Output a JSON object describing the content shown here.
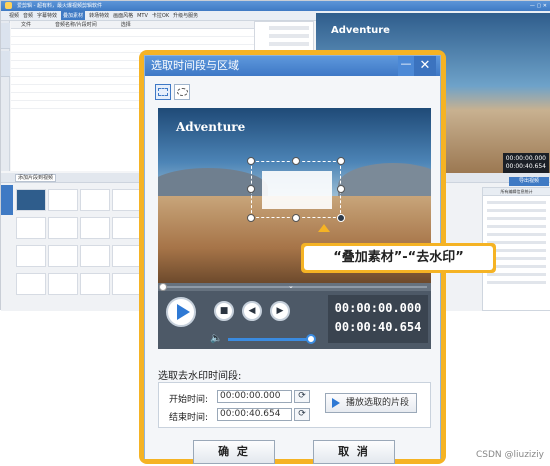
{
  "background_app": {
    "title": "爱剪辑 - 超有料，最火爆视频剪辑软件",
    "menu_items": [
      "视频",
      "音频",
      "字幕特效",
      "叠加素材",
      "转场特效",
      "画面风格",
      "MTV",
      "卡拉OK",
      "升级与服务"
    ],
    "active_menu": "叠加素材",
    "list_headers": [
      "文件",
      "音频名称/片段时间",
      "选择"
    ],
    "preview_title": "Adventure",
    "preview_timecode_1": "00:00:00.000",
    "preview_timecode_2": "00:00:40.654",
    "export_button": "导出视频",
    "timeline_tab": "添加片段到视频",
    "props_title": "所有编辑信息统计"
  },
  "dialog": {
    "title": "选取时间段与区域",
    "minimize": "—",
    "close": "✕",
    "video_title": "Adventure",
    "callout": "“叠加素材”-“去水印”",
    "time_current": "00:00:00.000",
    "time_total": "00:00:40.654",
    "section_label": "选取去水印时间段:",
    "start_label": "开始时间:",
    "start_value": "00:00:00.000",
    "end_label": "结束时间:",
    "end_value": "00:00:40.654",
    "play_selection": "播放选取的片段",
    "ok": "确 定",
    "cancel": "取 消",
    "volume_level": 1.0,
    "accent_color": "#f5b324"
  },
  "watermark": "CSDN @liuziziy",
  "icons": [
    "rect-select-icon",
    "ellipse-select-icon",
    "play-icon",
    "stop-icon",
    "prev-frame-icon",
    "next-frame-icon",
    "volume-icon",
    "reset-time-icon",
    "chevron-down-icon"
  ]
}
